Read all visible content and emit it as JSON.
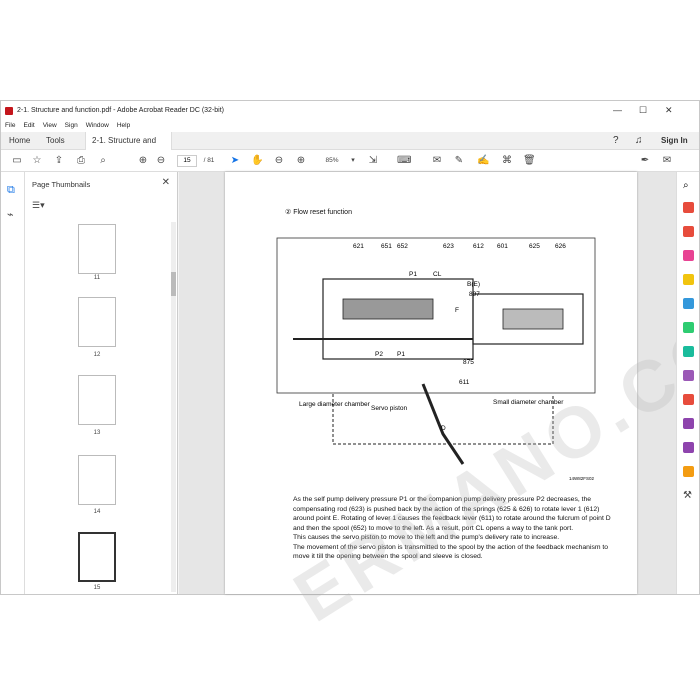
{
  "window": {
    "title": "2-1. Structure and function.pdf - Adobe Acrobat Reader DC (32-bit)",
    "minimize": "—",
    "maximize": "☐",
    "close": "✕"
  },
  "menu": [
    "File",
    "Edit",
    "View",
    "Sign",
    "Window",
    "Help"
  ],
  "tabs": {
    "home": "Home",
    "tools": "Tools",
    "doc": "2-1. Structure and f...",
    "doc_close": "×",
    "sign_in": "Sign In"
  },
  "toolbar": {
    "page_current": "15",
    "page_total": "/ 81",
    "zoom": "85%"
  },
  "panel": {
    "title": "Page Thumbnails",
    "close": "✕",
    "thumbs": [
      "11",
      "12",
      "13",
      "14",
      "15"
    ]
  },
  "page": {
    "heading": "② Flow reset function",
    "labels": [
      "621",
      "651",
      "652",
      "623",
      "612",
      "601",
      "625",
      "626",
      "P1",
      "CL",
      "B(E)",
      "897",
      "F",
      "P2",
      "P1",
      "875",
      "611",
      "Large diameter chamber",
      "Servo piston",
      "Small diameter chamber",
      "D"
    ],
    "fig_code": "14W82FS02",
    "paragraph": [
      "As the self pump delivery pressure P1 or the companion pump delivery pressure P2 decreases, the compensating rod (623) is pushed back by the action of the springs (625 & 626) to rotate lever 1 (612) around point E.  Rotating of lever 1 causes the feedback lever (611) to rotate around the fulcrum of point D and then the spool (652) to move to the left.  As a result, port CL opens a way to the tank port.",
      "This causes the servo piston to move to the left and the pump's delivery rate to increase.",
      "The movement of the servo piston is transmitted to the spool by the action of the feedback mechanism to move it till the opening between the spool and sleeve is closed."
    ],
    "watermark": "ERMANO.COM"
  }
}
